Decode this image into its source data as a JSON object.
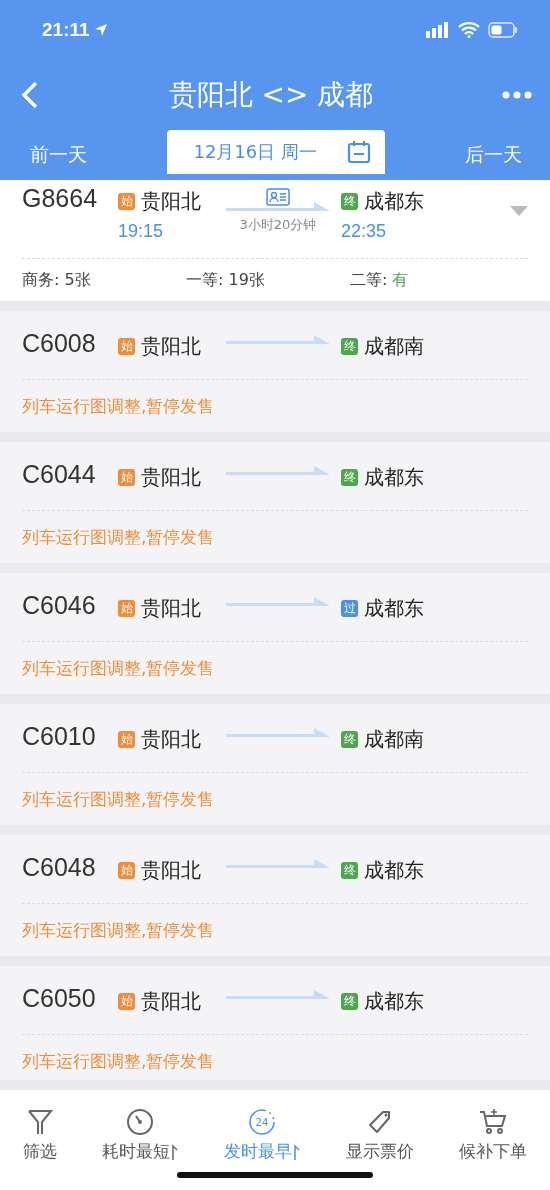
{
  "status_bar": {
    "time": "21:11"
  },
  "nav": {
    "title": "贵阳北 <> 成都"
  },
  "date_bar": {
    "prev": "前一天",
    "date": "12月16日 周一",
    "next": "后一天"
  },
  "trains": [
    {
      "number": "G8664",
      "from_badge": {
        "text": "始",
        "kind": "start"
      },
      "from": "贵阳北",
      "depart": "19:15",
      "duration": "3小时20分钟",
      "to_badge": {
        "text": "终",
        "kind": "end"
      },
      "to": "成都东",
      "arrive": "22:35",
      "seats": [
        {
          "label": "商务: ",
          "value": "5张",
          "available": false
        },
        {
          "label": "一等: ",
          "value": "19张",
          "available": false
        },
        {
          "label": "二等: ",
          "value": "有",
          "available": true
        }
      ],
      "on_sale": true
    },
    {
      "number": "C6008",
      "from_badge": {
        "text": "始",
        "kind": "start"
      },
      "from": "贵阳北",
      "to_badge": {
        "text": "终",
        "kind": "end"
      },
      "to": "成都南",
      "notice": "列车运行图调整,暂停发售",
      "on_sale": false
    },
    {
      "number": "C6044",
      "from_badge": {
        "text": "始",
        "kind": "start"
      },
      "from": "贵阳北",
      "to_badge": {
        "text": "终",
        "kind": "end"
      },
      "to": "成都东",
      "notice": "列车运行图调整,暂停发售",
      "on_sale": false
    },
    {
      "number": "C6046",
      "from_badge": {
        "text": "始",
        "kind": "start"
      },
      "from": "贵阳北",
      "to_badge": {
        "text": "过",
        "kind": "pass"
      },
      "to": "成都东",
      "notice": "列车运行图调整,暂停发售",
      "on_sale": false
    },
    {
      "number": "C6010",
      "from_badge": {
        "text": "始",
        "kind": "start"
      },
      "from": "贵阳北",
      "to_badge": {
        "text": "终",
        "kind": "end"
      },
      "to": "成都南",
      "notice": "列车运行图调整,暂停发售",
      "on_sale": false
    },
    {
      "number": "C6048",
      "from_badge": {
        "text": "始",
        "kind": "start"
      },
      "from": "贵阳北",
      "to_badge": {
        "text": "终",
        "kind": "end"
      },
      "to": "成都东",
      "notice": "列车运行图调整,暂停发售",
      "on_sale": false
    },
    {
      "number": "C6050",
      "from_badge": {
        "text": "始",
        "kind": "start"
      },
      "from": "贵阳北",
      "to_badge": {
        "text": "终",
        "kind": "end"
      },
      "to": "成都东",
      "notice": "列车运行图调整,暂停发售",
      "on_sale": false
    }
  ],
  "toolbar": [
    {
      "kind": "filter",
      "label": "筛选",
      "selected": false
    },
    {
      "kind": "duration",
      "label": "耗时最短",
      "selected": false
    },
    {
      "kind": "depart",
      "label": "发时最早",
      "icon_text": "24",
      "selected": true
    },
    {
      "kind": "price",
      "label": "显示票价",
      "selected": false
    },
    {
      "kind": "waitlist",
      "label": "候补下单",
      "selected": false
    }
  ]
}
